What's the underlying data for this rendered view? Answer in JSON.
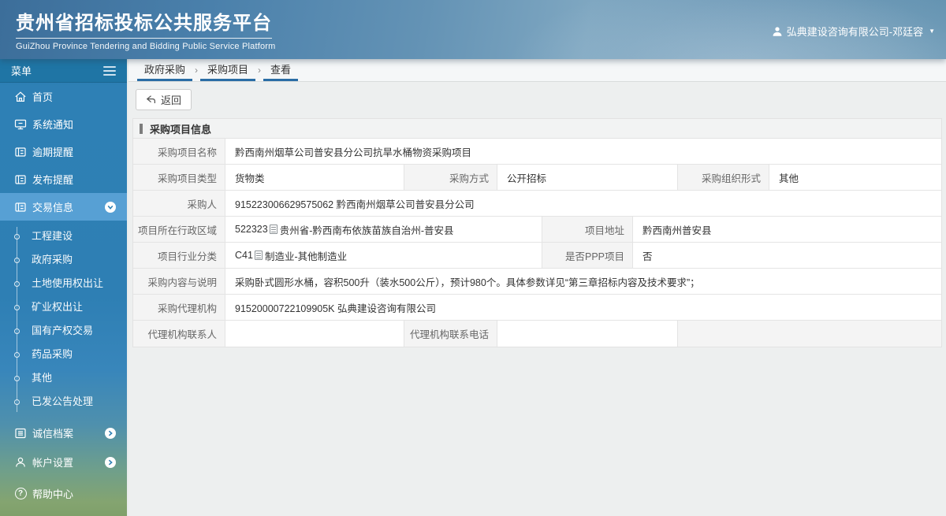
{
  "colors": {
    "accent_blue": "#2a6da5",
    "sidebar_blue": "#2e80b5",
    "active_item": "#57a0d4",
    "header_blue": "#4a80ab"
  },
  "header": {
    "title": "贵州省招标投标公共服务平台",
    "subtitle": "GuiZhou Province Tendering and Bidding Public Service Platform",
    "user": "弘典建设咨询有限公司-邓廷容"
  },
  "sidebar": {
    "menu_label": "菜单",
    "items": [
      {
        "label": "首页"
      },
      {
        "label": "系统通知"
      },
      {
        "label": "逾期提醒"
      },
      {
        "label": "发布提醒"
      },
      {
        "label": "交易信息"
      }
    ],
    "submenu": [
      {
        "label": "工程建设"
      },
      {
        "label": "政府采购"
      },
      {
        "label": "土地使用权出让"
      },
      {
        "label": "矿业权出让"
      },
      {
        "label": "国有产权交易"
      },
      {
        "label": "药品采购"
      },
      {
        "label": "其他"
      },
      {
        "label": "已发公告处理"
      }
    ],
    "bottom_items": [
      {
        "label": "诚信档案"
      },
      {
        "label": "帐户设置"
      },
      {
        "label": "帮助中心"
      }
    ],
    "help_glyph": "?"
  },
  "breadcrumb": {
    "items": [
      "政府采购",
      "采购项目",
      "查看"
    ],
    "separator": "›"
  },
  "toolbar": {
    "back_label": "返回"
  },
  "form": {
    "section_title": "采购项目信息",
    "project_name": {
      "label": "采购项目名称",
      "value": "黔西南州烟草公司普安县分公司抗旱水桶物资采购项目"
    },
    "project_type": {
      "label": "采购项目类型",
      "value": "货物类"
    },
    "purchase_method": {
      "label": "采购方式",
      "value": "公开招标"
    },
    "org_form": {
      "label": "采购组织形式",
      "value": "其他"
    },
    "purchaser": {
      "label": "采购人",
      "value": "915223006629575062 黔西南州烟草公司普安县分公司"
    },
    "region": {
      "label": "项目所在行政区域",
      "code": "522323",
      "value": "贵州省-黔西南布依族苗族自治州-普安县"
    },
    "address": {
      "label": "项目地址",
      "value": "黔西南州普安县"
    },
    "industry": {
      "label": "项目行业分类",
      "code": "C41",
      "value": "制造业-其他制造业"
    },
    "is_ppp": {
      "label": "是否PPP项目",
      "value": "否"
    },
    "content": {
      "label": "采购内容与说明",
      "value": "采购卧式圆形水桶，容积500升（装水500公斤），预计980个。具体参数详见“第三章招标内容及技术要求”；"
    },
    "agency": {
      "label": "采购代理机构",
      "value": "91520000722109905K 弘典建设咨询有限公司"
    },
    "agency_contact": {
      "label": "代理机构联系人",
      "value": ""
    },
    "agency_phone": {
      "label": "代理机构联系电话",
      "value": ""
    }
  }
}
